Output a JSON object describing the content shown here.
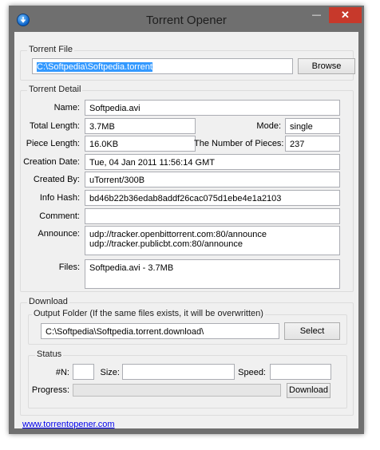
{
  "window": {
    "title": "Torrent Opener"
  },
  "torrent_file": {
    "group_label": "Torrent File",
    "path": "C:\\Softpedia\\Softpedia.torrent",
    "browse_label": "Browse"
  },
  "detail": {
    "group_label": "Torrent Detail",
    "name_label": "Name:",
    "name": "Softpedia.avi",
    "total_length_label": "Total Length:",
    "total_length": "3.7MB",
    "mode_label": "Mode:",
    "mode": "single",
    "piece_length_label": "Piece Length:",
    "piece_length": "16.0KB",
    "num_pieces_label": "The Number of Pieces:",
    "num_pieces": "237",
    "creation_date_label": "Creation Date:",
    "creation_date": "Tue, 04 Jan 2011 11:56:14 GMT",
    "created_by_label": "Created By:",
    "created_by": "uTorrent/300B",
    "info_hash_label": "Info Hash:",
    "info_hash": "bd46b22b36edab8addf26cac075d1ebe4e1a2103",
    "comment_label": "Comment:",
    "comment": "",
    "announce_label": "Announce:",
    "announce": "udp://tracker.openbittorrent.com:80/announce\nudp://tracker.publicbt.com:80/announce",
    "files_label": "Files:",
    "files": "Softpedia.avi - 3.7MB"
  },
  "download": {
    "group_label": "Download",
    "output_label": "Output Folder (If the same files exists, it will be overwritten)",
    "output_path": "C:\\Softpedia\\Softpedia.torrent.download\\",
    "select_label": "Select"
  },
  "status": {
    "group_label": "Status",
    "n_label": "#N:",
    "n": "",
    "size_label": "Size:",
    "size": "",
    "speed_label": "Speed:",
    "speed": "",
    "progress_label": "Progress:",
    "progress": 0,
    "download_label": "Download"
  },
  "footer": {
    "link": "www.torrentopener.com"
  },
  "colors": {
    "titlebar": "#6f6f6f",
    "close": "#c7392b",
    "selection": "#3399ff"
  }
}
